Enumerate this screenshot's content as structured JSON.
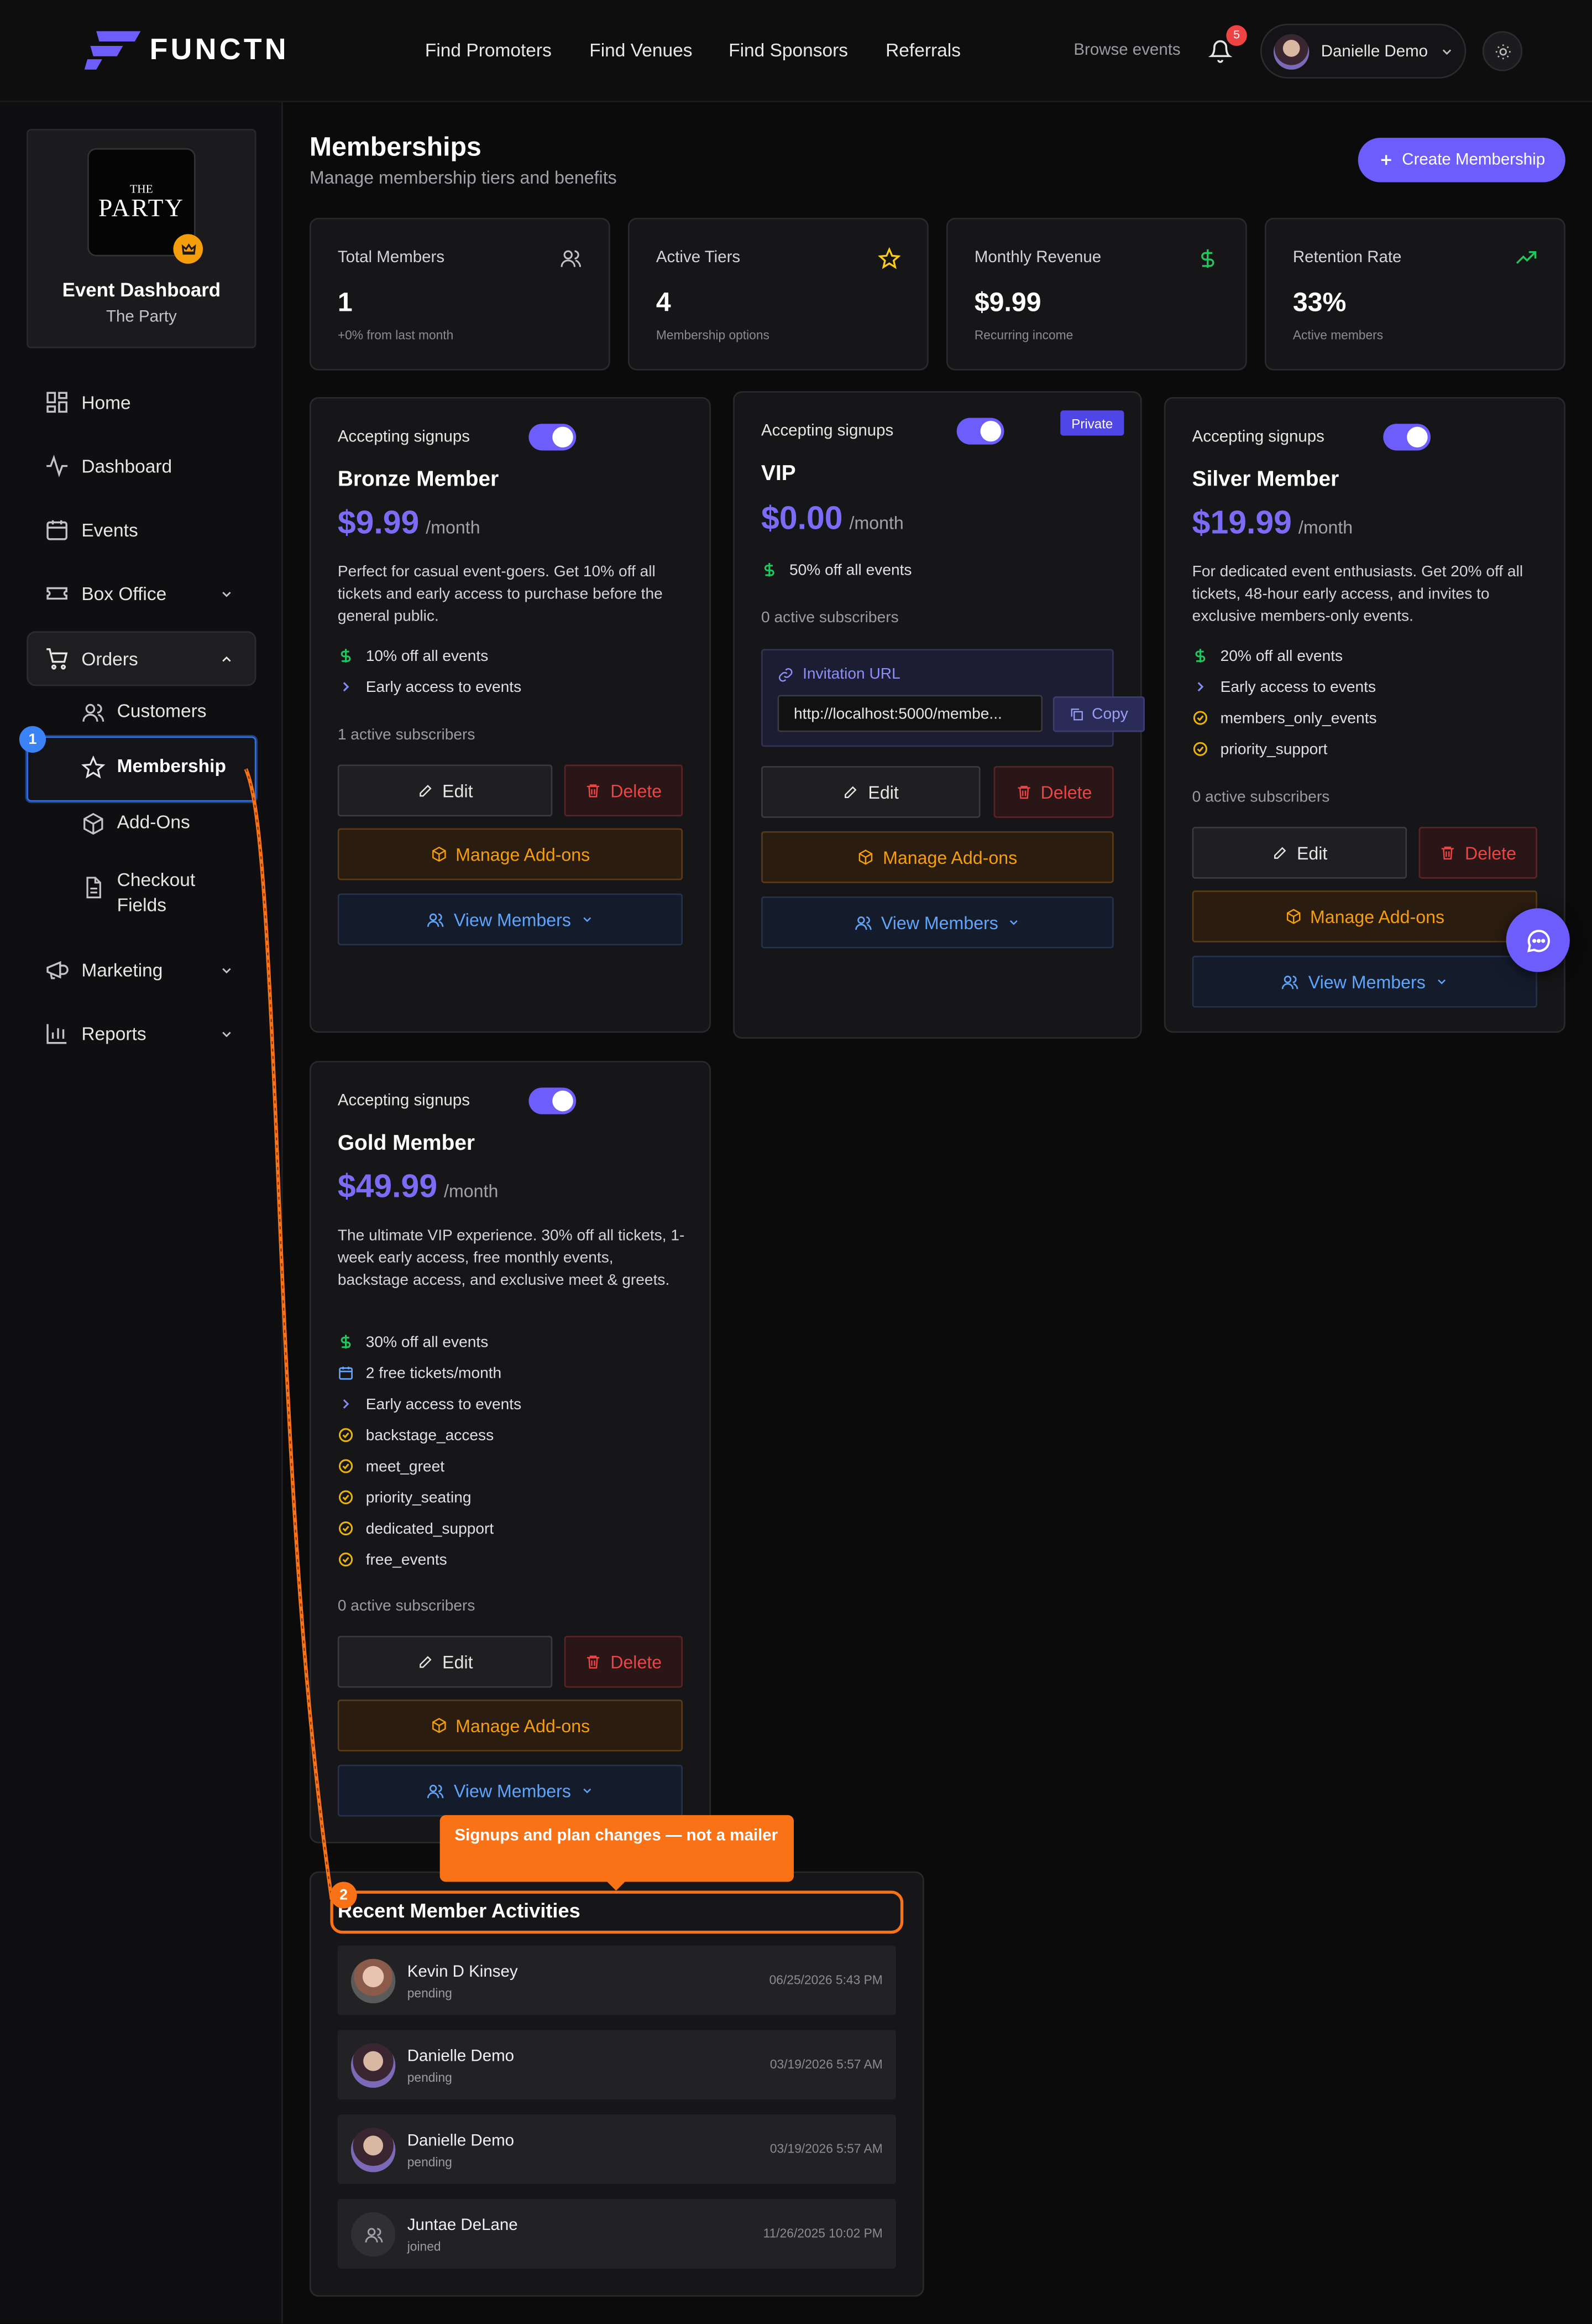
{
  "brand": {
    "name": "FUNCTN"
  },
  "topnav": {
    "items": [
      "Find Promoters",
      "Find Venues",
      "Find Sponsors",
      "Referrals"
    ],
    "browse": "Browse events",
    "notif_count": "5",
    "user_name": "Danielle Demo"
  },
  "sidebar": {
    "profile": {
      "logo_line1": "THE",
      "logo_line2": "PARTY",
      "title": "Event Dashboard",
      "subtitle": "The Party"
    },
    "items": [
      "Home",
      "Dashboard",
      "Events",
      "Box Office",
      "Orders",
      "Marketing",
      "Reports"
    ],
    "sub_items": [
      "Customers",
      "Membership",
      "Add-Ons",
      "Checkout",
      "Fields"
    ]
  },
  "page": {
    "title": "Memberships",
    "subtitle": "Manage membership tiers and benefits",
    "create_label": "Create Membership"
  },
  "stats": [
    {
      "label": "Total Members",
      "value": "1",
      "note": "+0% from last month"
    },
    {
      "label": "Active Tiers",
      "value": "4",
      "note": "Membership options"
    },
    {
      "label": "Monthly Revenue",
      "value": "$9.99",
      "note": "Recurring income"
    },
    {
      "label": "Retention Rate",
      "value": "33%",
      "note": "Active members"
    }
  ],
  "tier_common": {
    "accepting": "Accepting signups",
    "per": "/month",
    "edit": "Edit",
    "delete": "Delete",
    "addons": "Manage Add-ons",
    "view": "View Members"
  },
  "tiers": {
    "bronze": {
      "name": "Bronze Member",
      "price": "$9.99",
      "desc": "Perfect for casual event-goers. Get 10% off all tickets and early access to purchase before the general public.",
      "features": [
        "10% off all events",
        "Early access to events"
      ],
      "subs": "1 active subscribers"
    },
    "vip": {
      "name": "VIP",
      "price": "$0.00",
      "private": "Private",
      "features": [
        "50% off all events"
      ],
      "subs": "0 active subscribers",
      "inv_label": "Invitation URL",
      "inv_url": "http://localhost:5000/membe...",
      "copy": "Copy"
    },
    "silver": {
      "name": "Silver Member",
      "price": "$19.99",
      "desc": "For dedicated event enthusiasts. Get 20% off all tickets, 48-hour early access, and invites to exclusive members-only events.",
      "features": [
        "20% off all events",
        "Early access to events",
        "members_only_events",
        "priority_support"
      ],
      "subs": "0 active subscribers"
    },
    "gold": {
      "name": "Gold Member",
      "price": "$49.99",
      "desc": "The ultimate VIP experience. 30% off all tickets, 1-week early access, free monthly events, backstage access, and exclusive meet & greets.",
      "features": [
        "30% off all events",
        "2 free tickets/month",
        "Early access to events",
        "backstage_access",
        "meet_greet",
        "priority_seating",
        "dedicated_support",
        "free_events"
      ],
      "subs": "0 active subscribers"
    }
  },
  "activities": {
    "title": "Recent Member Activities",
    "rows": [
      {
        "name": "Kevin D Kinsey",
        "status": "pending",
        "time": "06/25/2026 5:43 PM"
      },
      {
        "name": "Danielle Demo",
        "status": "pending",
        "time": "03/19/2026 5:57 AM"
      },
      {
        "name": "Danielle Demo",
        "status": "pending",
        "time": "03/19/2026 5:57 AM"
      },
      {
        "name": "Juntae DeLane",
        "status": "joined",
        "time": "11/26/2025 10:02 PM"
      }
    ]
  },
  "annotations": {
    "step1": "1",
    "step2": "2",
    "callout": "Signups and plan changes — not a mailer"
  },
  "colors": {
    "accent": "#6d5dfc",
    "orange": "#f97316",
    "danger": "#ef4444",
    "addon": "#f59e0b",
    "link": "#60a5fa"
  }
}
